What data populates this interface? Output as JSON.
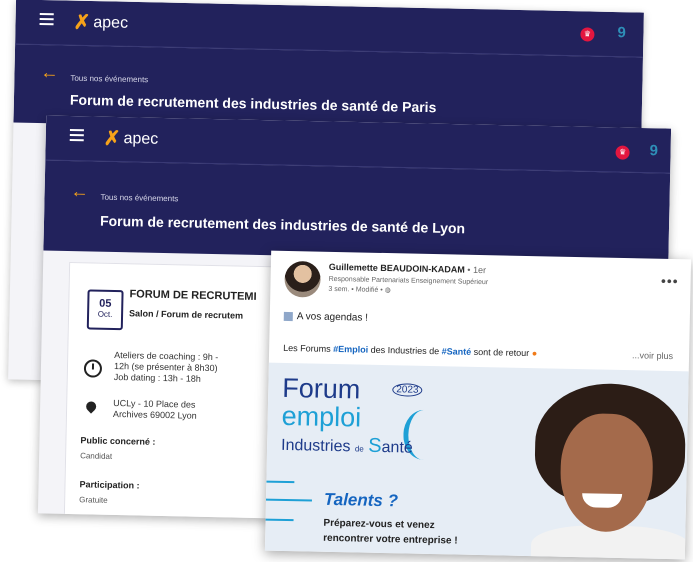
{
  "colors": {
    "navy": "#22225c",
    "accent": "#f6a21a",
    "link": "#1565c0"
  },
  "app_back": {
    "logo_text": "apec",
    "breadcrumb": "Tous nos événements",
    "title": "Forum de recrutement des industries de santé de Paris",
    "icons": [
      "menu-icon",
      "back-arrow-icon",
      "crown-icon",
      "nine-badge-icon"
    ]
  },
  "app_front": {
    "logo_text": "apec",
    "breadcrumb": "Tous nos événements",
    "title": "Forum de recrutement des industries de santé de Lyon",
    "date_day": "05",
    "date_month": "Oct.",
    "event_name": "FORUM DE RECRUTEMI",
    "event_type": "Salon / Forum de recrutem",
    "schedule": [
      "Ateliers de coaching : 9h -",
      "12h (se présenter à 8h30)",
      "Job dating : 13h - 18h"
    ],
    "address": [
      "UCLy - 10 Place des",
      "Archives 69002 Lyon"
    ],
    "audience_label": "Public concerné :",
    "audience_value": "Candidat",
    "participation_label": "Participation :",
    "participation_value": "Gratuite"
  },
  "post": {
    "author": "Guillemette BEAUDOIN-KADAM",
    "degree": "• 1er",
    "role": "Responsable Partenariats Enseignement Supérieur",
    "meta": "3 sem. • Modifié •",
    "agenda": "A vos agendas !",
    "text_prefix": "Les Forums ",
    "tag_emploi": "#Emploi",
    "text_middle": " des Industries de ",
    "tag_sante": "#Santé",
    "text_suffix": " sont de retour",
    "see_more": "...voir plus",
    "visual": {
      "word_forum": "Forum",
      "year": "2023",
      "word_emploi": "emploi",
      "word_industries": "Industries",
      "word_de": "de",
      "word_sante": "anté",
      "talents": "Talents ?",
      "cta_line1": "Préparez-vous et venez",
      "cta_line2": "rencontrer votre entreprise !"
    }
  }
}
